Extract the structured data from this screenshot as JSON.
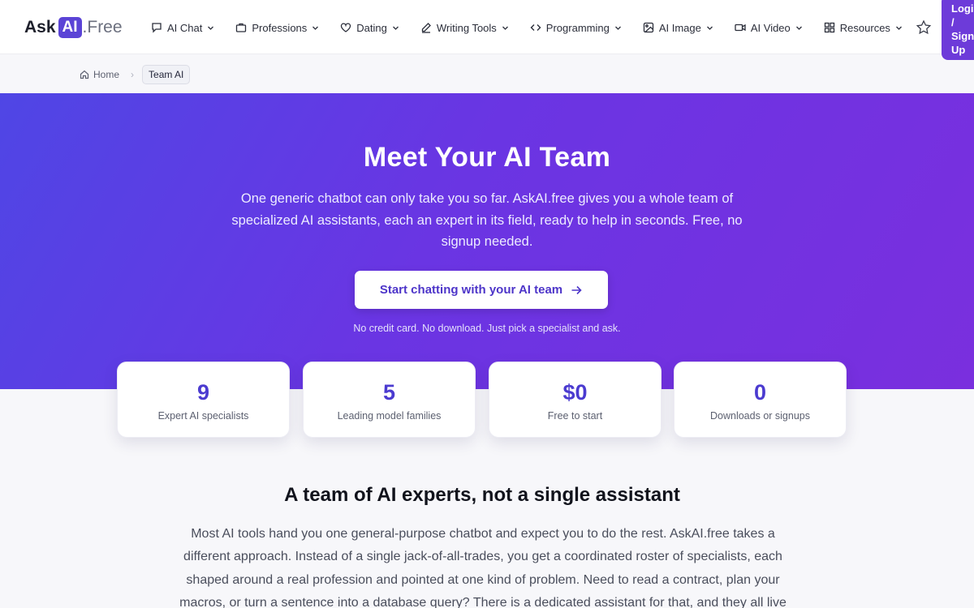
{
  "brand": {
    "ask": "Ask",
    "ai": "AI",
    "free": ".Free"
  },
  "nav": [
    {
      "label": "AI Chat",
      "icon": "chat-icon"
    },
    {
      "label": "Professions",
      "icon": "briefcase-icon"
    },
    {
      "label": "Dating",
      "icon": "heart-icon"
    },
    {
      "label": "Writing Tools",
      "icon": "pen-icon"
    },
    {
      "label": "Programming",
      "icon": "code-icon"
    },
    {
      "label": "AI Image",
      "icon": "image-icon"
    },
    {
      "label": "AI Video",
      "icon": "video-icon"
    },
    {
      "label": "Resources",
      "icon": "grid-icon"
    }
  ],
  "login": {
    "line1": "Login",
    "line2": "/",
    "line3": "Sign",
    "line4": "Up"
  },
  "breadcrumb": {
    "home": "Home",
    "current": "Team AI"
  },
  "hero": {
    "title": "Meet Your AI Team",
    "subtitle": "One generic chatbot can only take you so far. AskAI.free gives you a whole team of specialized AI assistants, each an expert in its field, ready to help in seconds. Free, no signup needed.",
    "cta": "Start chatting with your AI team",
    "note": "No credit card. No download. Just pick a specialist and ask."
  },
  "stats": [
    {
      "value": "9",
      "label": "Expert AI specialists"
    },
    {
      "value": "5",
      "label": "Leading model families"
    },
    {
      "value": "$0",
      "label": "Free to start"
    },
    {
      "value": "0",
      "label": "Downloads or signups"
    }
  ],
  "section": {
    "title": "A team of AI experts, not a single assistant",
    "body": "Most AI tools hand you one general-purpose chatbot and expect you to do the rest. AskAI.free takes a different approach. Instead of a single jack-of-all-trades, you get a coordinated roster of specialists, each shaped around a real profession and pointed at one kind of problem. Need to read a contract, plan your macros, or turn a sentence into a database query? There is a dedicated assistant for that, and they all live in"
  },
  "colors": {
    "accent": "#5b44d6",
    "hero_start": "#4f46e5",
    "hero_end": "#7a2fde",
    "login_bg": "#6d3bd9"
  }
}
